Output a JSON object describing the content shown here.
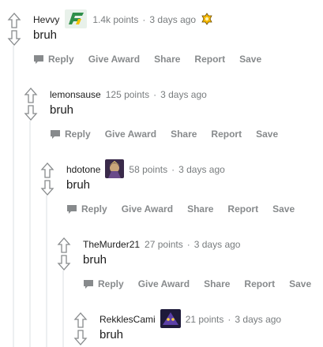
{
  "comments": [
    {
      "username": "Hevvy",
      "points": "1.4k points",
      "time": "3 days ago",
      "body": "bruh"
    },
    {
      "username": "lemonsause",
      "points": "125 points",
      "time": "3 days ago",
      "body": "bruh"
    },
    {
      "username": "hdotone",
      "points": "58 points",
      "time": "3 days ago",
      "body": "bruh"
    },
    {
      "username": "TheMurder21",
      "points": "27 points",
      "time": "3 days ago",
      "body": "bruh"
    },
    {
      "username": "RekklesCami",
      "points": "21 points",
      "time": "3 days ago",
      "body": "bruh"
    }
  ],
  "actions": {
    "reply": "Reply",
    "give_award": "Give Award",
    "share": "Share",
    "report": "Report",
    "save": "Save"
  },
  "dot": "·",
  "icons": {
    "upvote": "upvote-arrow-icon",
    "downvote": "downvote-arrow-icon",
    "reply": "speech-bubble-icon",
    "flair": "team-logo-flair-icon",
    "avatar": "champion-avatar-icon",
    "award": "award-badge-icon"
  },
  "colors": {
    "meta": "#787c7e",
    "action": "#878a8c",
    "thread": "#edeff1",
    "flair_green": "#2f8f4a",
    "award_gold": "#f5b800"
  }
}
